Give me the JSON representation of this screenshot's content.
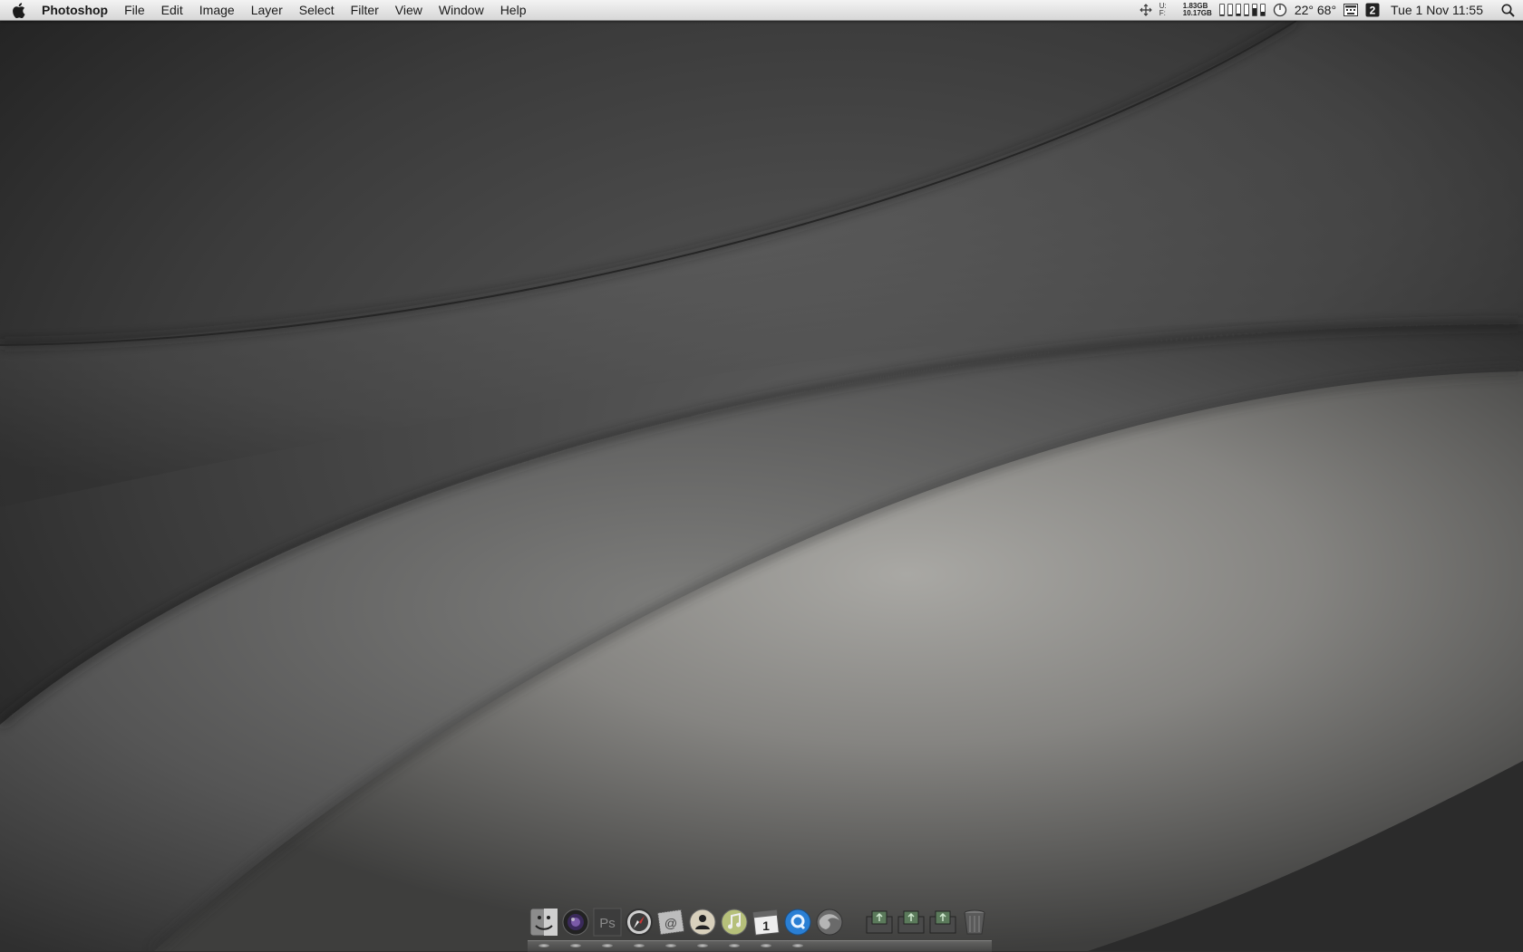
{
  "menubar": {
    "apple_icon": "apple-logo-icon",
    "app_name": "Photoshop",
    "menus": [
      "File",
      "Edit",
      "Image",
      "Layer",
      "Select",
      "Filter",
      "View",
      "Window",
      "Help"
    ],
    "status": {
      "network_icon": "network-activity-icon",
      "memory_used_label": "U:",
      "memory_used": "1.83GB",
      "memory_free_label": "F:",
      "memory_free": "10.17GB",
      "cpu_gauge_levels": [
        0.1,
        0.1,
        0.15,
        0.1,
        0.7,
        0.3
      ],
      "clock_icon": "timer-icon",
      "temperatures": "22° 68°",
      "keyboard_icon": "keyboard-viewer-icon",
      "spaces_icon": "spaces-number-icon",
      "spaces_number": "2",
      "datetime": "Tue 1 Nov  11:55",
      "search_icon": "spotlight-search-icon"
    }
  },
  "dock": {
    "apps": [
      {
        "name": "Finder",
        "icon": "finder-icon",
        "running": true
      },
      {
        "name": "Aperture",
        "icon": "aperture-lens-icon",
        "running": true
      },
      {
        "name": "Photoshop",
        "icon": "photoshop-icon",
        "label": "Ps",
        "running": true
      },
      {
        "name": "Safari",
        "icon": "safari-compass-icon",
        "running": true
      },
      {
        "name": "Mail",
        "icon": "mail-stamp-icon",
        "running": true
      },
      {
        "name": "Address Book",
        "icon": "contacts-icon",
        "running": true
      },
      {
        "name": "iTunes",
        "icon": "itunes-note-icon",
        "running": true
      },
      {
        "name": "iCal",
        "icon": "calendar-icon",
        "label": "1",
        "running": true
      },
      {
        "name": "QuickTime",
        "icon": "quicktime-icon",
        "running": true
      },
      {
        "name": "Firefox",
        "icon": "firefox-globe-icon",
        "running": false
      }
    ],
    "stacks": [
      {
        "name": "Stack 1",
        "icon": "folder-stack-icon"
      },
      {
        "name": "Stack 2",
        "icon": "folder-stack-icon"
      },
      {
        "name": "Stack 3",
        "icon": "folder-stack-icon"
      },
      {
        "name": "Trash",
        "icon": "trash-icon"
      }
    ]
  }
}
